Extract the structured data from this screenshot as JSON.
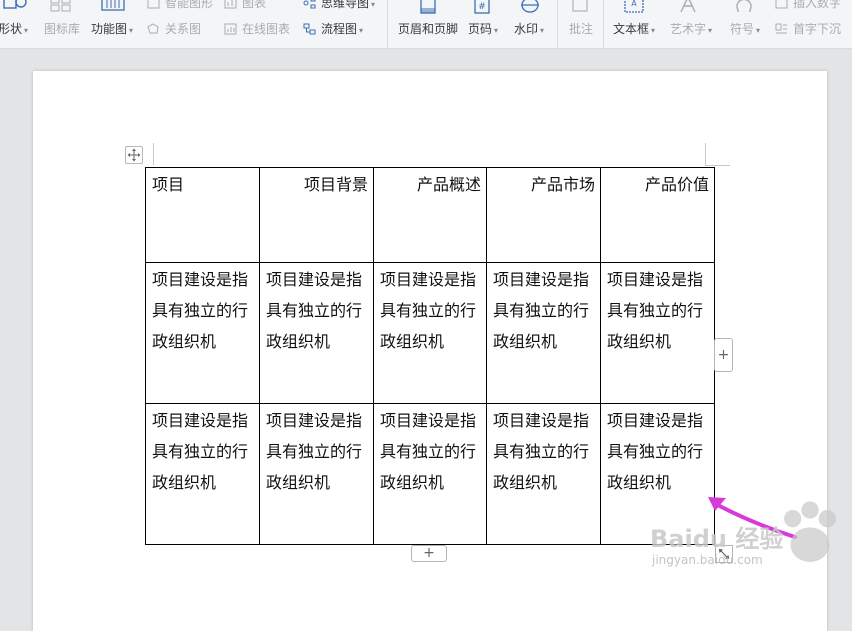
{
  "ribbon": {
    "row1": {
      "smart_graphic": "智能图形",
      "chart": "图表",
      "mind_map": "思维导图",
      "insert_number": "插入数字"
    },
    "row2": {
      "shape": "形状",
      "icon_library": "图标库",
      "function_chart": "功能图",
      "relationship_chart": "关系图",
      "online_chart": "在线图表",
      "flowchart": "流程图",
      "header_footer": "页眉和页脚",
      "page_number": "页码",
      "watermark": "水印",
      "comment": "批注",
      "text_box": "文本框",
      "word_art": "艺术字",
      "symbol": "符号",
      "drop_cap": "首字下沉"
    }
  },
  "table": {
    "header": [
      "项目",
      "项目背景",
      "产品概述",
      "产品市场",
      "产品价值"
    ],
    "rows": [
      [
        "项目建设是指具有独立的行政组织机",
        "项目建设是指具有独立的行政组织机",
        "项目建设是指具有独立的行政组织机",
        "项目建设是指具有独立的行政组织机",
        "项目建设是指具有独立的行政组织机"
      ],
      [
        "项目建设是指具有独立的行政组织机",
        "项目建设是指具有独立的行政组织机",
        "项目建设是指具有独立的行政组织机",
        "项目建设是指具有独立的行政组织机",
        "项目建设是指具有独立的行政组织机"
      ]
    ]
  },
  "controls": {
    "add_column": "+",
    "add_row": "+"
  },
  "watermark": {
    "text": "Baidu 经验",
    "url": "jingyan.baidu.com"
  },
  "colors": {
    "arrow": "#d63bd8",
    "table_border": "#000000",
    "ribbon_bg": "#f4f5f7",
    "canvas_bg": "#e3e4e6"
  }
}
